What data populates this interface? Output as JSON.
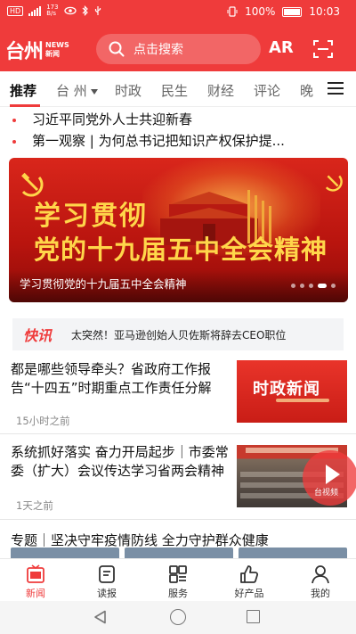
{
  "status_bar": {
    "network_badge": "HD",
    "net_speed_value": "173",
    "net_speed_unit": "B/s",
    "battery": "100%",
    "time": "10:03"
  },
  "header": {
    "logo_main": "台州",
    "logo_en": "NEWS",
    "logo_cn": "新闻",
    "search_placeholder": "点击搜索",
    "ar_label": "AR",
    "scan_icon": "scan-icon"
  },
  "tabs": [
    {
      "label": "推荐",
      "active": true
    },
    {
      "label": "台 州",
      "dropdown": true
    },
    {
      "label": "时政"
    },
    {
      "label": "民生"
    },
    {
      "label": "财经"
    },
    {
      "label": "评论"
    },
    {
      "label": "晚"
    }
  ],
  "headlines": [
    "习近平同党外人士共迎新春",
    "第一观察 | 为何总书记把知识产权保护提..."
  ],
  "banner": {
    "line1": "学习贯彻",
    "line2": "党的十九届五中全会精神",
    "caption": "学习贯彻党的十九届五中全会精神",
    "slide_count": 5,
    "current_slide": 3
  },
  "flash": {
    "tag": "快讯",
    "text": "太突然！亚马逊创始人贝佐斯将辞去CEO职位"
  },
  "articles": [
    {
      "title": "都是哪些领导牵头？省政府工作报告“十四五”时期重点工作责任分解",
      "time": "15小时之前",
      "thumb_text": "时政新闻"
    },
    {
      "title": "系统抓好落实 奋力开局起步｜市委常委（扩大）会议传达学习省两会精神",
      "time": "1天之前",
      "float_label": "台视频"
    }
  ],
  "topic": "专题｜坚决守牢疫情防线 全力守护群众健康",
  "bottom_nav": [
    {
      "label": "新闻",
      "icon": "news-icon",
      "active": true
    },
    {
      "label": "读报",
      "icon": "newspaper-icon"
    },
    {
      "label": "服务",
      "icon": "services-icon"
    },
    {
      "label": "好产品",
      "icon": "thumbs-up-icon"
    },
    {
      "label": "我的",
      "icon": "profile-icon"
    }
  ],
  "colors": {
    "brand_red": "#ef3b3b",
    "banner_gold": "#ffd64a"
  }
}
